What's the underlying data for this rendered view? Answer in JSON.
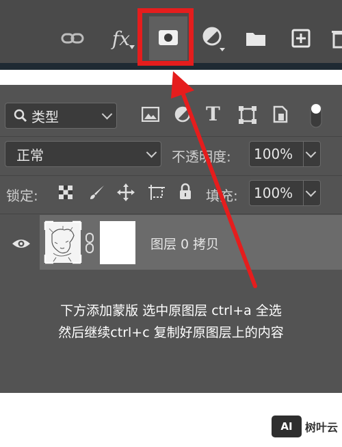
{
  "layers_panel": {
    "filter_kind": "类型",
    "blend_mode": "正常",
    "opacity_label": "不透明度:",
    "opacity_value": "100%",
    "lock_label": "锁定:",
    "fill_label": "填充:",
    "fill_value": "100%",
    "layer_name": "图层 0 拷贝"
  },
  "annotation": {
    "line1": "下方添加蒙版 选中原图层 ctrl+a 全选",
    "line2": "然后继续ctrl+c 复制好原图层上的内容"
  },
  "watermark": {
    "logo": "AI",
    "name": "树叶云"
  },
  "colors": {
    "highlight": "#e51d1d",
    "panel_bg": "#535353",
    "toolbar_bg": "#4a4a4a"
  }
}
